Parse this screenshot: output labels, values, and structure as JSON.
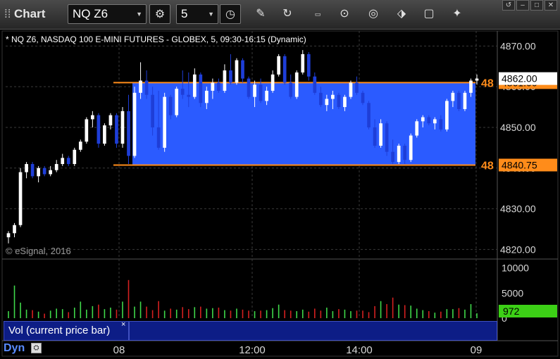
{
  "toolbar": {
    "title": "Chart",
    "symbol": "NQ Z6",
    "interval": "5",
    "icons": [
      "settings-icon",
      "clock-icon",
      "pencil-icon",
      "refresh-icon",
      "get-icon",
      "play-icon",
      "compass-icon",
      "link-icon",
      "comment-icon",
      "twitter-icon"
    ]
  },
  "window_controls": [
    "↺",
    "–",
    "□",
    "✕"
  ],
  "chart": {
    "description": "* NQ Z6, NASDAQ 100 E-MINI FUTURES - GLOBEX, 5, 09:30-16:15 (Dynamic)",
    "copyright": "© eSignal, 2016",
    "price_scale_labels": [
      "4870.00",
      "4860.00",
      "4850.00",
      "4840.00",
      "4830.00",
      "4820.00"
    ],
    "time_labels": [
      "08",
      "12:00",
      "14:00",
      "09"
    ],
    "last_price": "4862.00",
    "range_high": "4861.00",
    "range_low": "4840.75",
    "range_marker_text": "48",
    "volume_scale_labels": [
      "10000",
      "5000",
      "0"
    ],
    "volume_last": "972",
    "study_label": "Vol (current price bar)",
    "study_close": "×",
    "dyn_label": "Dyn",
    "dyn_icon": "⛭"
  },
  "colors": {
    "range_box": "#2b5bff",
    "range_line": "#ff8c1a",
    "up_candle": "#ffffff",
    "down_candle": "#1e3ed8",
    "vol_up": "#3fd84a",
    "vol_down": "#d42020",
    "volume_highlight": "#3cd016"
  },
  "chart_data": {
    "type": "candlestick",
    "ylim": [
      4818,
      4873
    ],
    "bars": [
      [
        4823,
        4824.5,
        4821.5,
        4824
      ],
      [
        4824,
        4826.5,
        4823,
        4826
      ],
      [
        4826,
        4840,
        4825.5,
        4839
      ],
      [
        4839,
        4841.5,
        4837.5,
        4841
      ],
      [
        4841,
        4841.5,
        4837.5,
        4838
      ],
      [
        4838,
        4840.5,
        4836.5,
        4840
      ],
      [
        4840,
        4840.5,
        4838,
        4838.5
      ],
      [
        4838.5,
        4840.5,
        4838,
        4839.5
      ],
      [
        4839.5,
        4842,
        4839,
        4841
      ],
      [
        4841,
        4843.5,
        4840.5,
        4842.5
      ],
      [
        4842.5,
        4843,
        4840.5,
        4841
      ],
      [
        4841,
        4845,
        4840.5,
        4844.5
      ],
      [
        4844.5,
        4847,
        4844,
        4846.5
      ],
      [
        4846.5,
        4852.5,
        4846,
        4852
      ],
      [
        4852,
        4854,
        4850,
        4853
      ],
      [
        4853,
        4853.5,
        4845,
        4846
      ],
      [
        4846,
        4851,
        4845.5,
        4850.5
      ],
      [
        4850.5,
        4853.5,
        4849.5,
        4853
      ],
      [
        4853,
        4853.5,
        4845,
        4846
      ],
      [
        4846,
        4855,
        4845,
        4854
      ],
      [
        4854,
        4858,
        4841,
        4843
      ],
      [
        4843,
        4860,
        4842.5,
        4858.5
      ],
      [
        4858.5,
        4866,
        4857,
        4861.5
      ],
      [
        4861.5,
        4864,
        4857,
        4858
      ],
      [
        4858,
        4860,
        4848,
        4850
      ],
      [
        4850,
        4859,
        4844.5,
        4845
      ],
      [
        4845,
        4858.5,
        4844,
        4857.5
      ],
      [
        4857.5,
        4858,
        4852,
        4853
      ],
      [
        4853,
        4860,
        4852.5,
        4859.5
      ],
      [
        4859.5,
        4864,
        4857,
        4858
      ],
      [
        4858,
        4863.5,
        4855,
        4857.5
      ],
      [
        4857.5,
        4864.5,
        4857,
        4863
      ],
      [
        4863,
        4863.5,
        4855,
        4856
      ],
      [
        4856,
        4860,
        4854.5,
        4859
      ],
      [
        4859,
        4862,
        4857,
        4861
      ],
      [
        4861,
        4862,
        4858.5,
        4859
      ],
      [
        4859,
        4865.5,
        4858.5,
        4864
      ],
      [
        4864,
        4868,
        4860.5,
        4861
      ],
      [
        4861,
        4867,
        4860.5,
        4866.5
      ],
      [
        4866.5,
        4867,
        4861,
        4862
      ],
      [
        4862,
        4862.5,
        4857,
        4857.5
      ],
      [
        4857.5,
        4861.5,
        4855,
        4860.5
      ],
      [
        4860.5,
        4862,
        4856,
        4856.5
      ],
      [
        4856.5,
        4860,
        4855.5,
        4859
      ],
      [
        4859,
        4864,
        4858.5,
        4863
      ],
      [
        4863,
        4868,
        4862.5,
        4867.5
      ],
      [
        4867.5,
        4868,
        4860.5,
        4861
      ],
      [
        4861,
        4863,
        4857,
        4857.5
      ],
      [
        4857.5,
        4864,
        4857,
        4863.5
      ],
      [
        4863.5,
        4869,
        4863,
        4868
      ],
      [
        4868,
        4868.5,
        4861.5,
        4862.5
      ],
      [
        4862.5,
        4863.5,
        4858,
        4858.5
      ],
      [
        4858.5,
        4860,
        4855,
        4855.5
      ],
      [
        4855.5,
        4858,
        4854,
        4857
      ],
      [
        4857,
        4859,
        4854.5,
        4858
      ],
      [
        4858,
        4858.5,
        4854.5,
        4855
      ],
      [
        4855,
        4858,
        4854,
        4857.5
      ],
      [
        4857.5,
        4861.5,
        4857,
        4861
      ],
      [
        4861,
        4862.5,
        4858,
        4858.5
      ],
      [
        4858.5,
        4859,
        4855.5,
        4856
      ],
      [
        4856,
        4856.5,
        4849.5,
        4850
      ],
      [
        4850,
        4852,
        4845,
        4845.5
      ],
      [
        4845.5,
        4852,
        4845,
        4851
      ],
      [
        4851,
        4851.5,
        4843,
        4844
      ],
      [
        4844,
        4847,
        4841,
        4841.5
      ],
      [
        4841.5,
        4846,
        4841,
        4845.5
      ],
      [
        4845.5,
        4846,
        4841,
        4842
      ],
      [
        4842,
        4848.5,
        4841.5,
        4848
      ],
      [
        4848,
        4852,
        4847.5,
        4851.5
      ],
      [
        4851.5,
        4853,
        4850,
        4852.5
      ],
      [
        4852.5,
        4853,
        4850.5,
        4851
      ],
      [
        4851,
        4852.5,
        4849.5,
        4852
      ],
      [
        4852,
        4853,
        4849,
        4849.5
      ],
      [
        4849.5,
        4857,
        4849,
        4856.5
      ],
      [
        4856.5,
        4859,
        4855,
        4858.5
      ],
      [
        4858.5,
        4859,
        4854,
        4854.5
      ],
      [
        4854.5,
        4859,
        4854,
        4858.5
      ],
      [
        4858.5,
        4862,
        4857.5,
        4861.5
      ],
      [
        4861.5,
        4863,
        4860.5,
        4862
      ]
    ],
    "volume": [
      1400,
      6500,
      3100,
      1700,
      1600,
      1300,
      900,
      1500,
      1900,
      1800,
      1200,
      2100,
      3300,
      1700,
      2400,
      2700,
      1800,
      2100,
      1700,
      3300,
      7600,
      2300,
      3300,
      2300,
      1600,
      3400,
      1500,
      1900,
      1700,
      2200,
      1800,
      2200,
      2300,
      1900,
      2000,
      2100,
      1600,
      1500,
      1900,
      1700,
      1500,
      1400,
      1500,
      1600,
      2000,
      2700,
      1600,
      1500,
      1400,
      1700,
      1300,
      1900,
      1500,
      2100,
      1400,
      1800,
      1700,
      1400,
      1500,
      1500,
      1200,
      2400,
      3400,
      2800,
      4100,
      2700,
      2600,
      2500,
      1900,
      1600,
      1400,
      1100,
      1300,
      1800,
      1800,
      2000,
      1700,
      2800,
      972
    ],
    "range_box": {
      "high": 4861,
      "low": 4840.75
    }
  }
}
